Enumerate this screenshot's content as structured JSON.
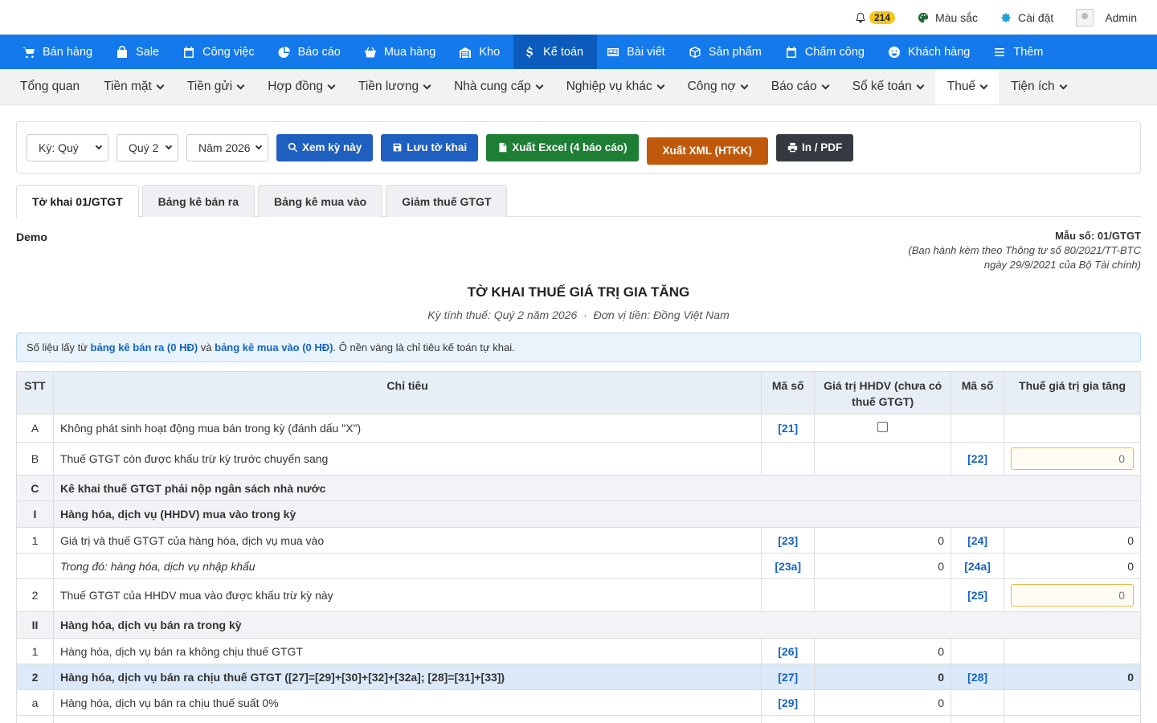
{
  "topbar": {
    "notif_count": "214",
    "color_label": "Màu sắc",
    "settings_label": "Cài đặt",
    "user_label": "Admin"
  },
  "mainnav": [
    {
      "label": "Bán hàng",
      "icon": "cart-icon"
    },
    {
      "label": "Sale",
      "icon": "bag-icon"
    },
    {
      "label": "Công việc",
      "icon": "calendar-icon"
    },
    {
      "label": "Báo cáo",
      "icon": "pie-chart-icon"
    },
    {
      "label": "Mua hàng",
      "icon": "basket-icon"
    },
    {
      "label": "Kho",
      "icon": "warehouse-icon"
    },
    {
      "label": "Kế toán",
      "icon": "dollar-icon",
      "active": true
    },
    {
      "label": "Bài viết",
      "icon": "article-icon"
    },
    {
      "label": "Sản phẩm",
      "icon": "box-icon"
    },
    {
      "label": "Chấm công",
      "icon": "calendar-check-icon"
    },
    {
      "label": "Khách hàng",
      "icon": "smile-icon"
    },
    {
      "label": "Thêm",
      "icon": "menu-icon"
    }
  ],
  "subnav": [
    {
      "label": "Tổng quan",
      "dropdown": false
    },
    {
      "label": "Tiền mặt",
      "dropdown": true
    },
    {
      "label": "Tiền gửi",
      "dropdown": true
    },
    {
      "label": "Hợp đồng",
      "dropdown": true
    },
    {
      "label": "Tiền lương",
      "dropdown": true
    },
    {
      "label": "Nhà cung cấp",
      "dropdown": true
    },
    {
      "label": "Nghiệp vụ khác",
      "dropdown": true
    },
    {
      "label": "Công nợ",
      "dropdown": true
    },
    {
      "label": "Báo cáo",
      "dropdown": true
    },
    {
      "label": "Sổ kế toán",
      "dropdown": true
    },
    {
      "label": "Thuế",
      "dropdown": true,
      "active": true
    },
    {
      "label": "Tiện ích",
      "dropdown": true
    }
  ],
  "toolbar": {
    "period_type": "Kỳ: Quý",
    "quarter": "Quý 2",
    "year": "Năm 2026",
    "view_btn": "Xem kỳ này",
    "save_btn": "Lưu tờ khai",
    "excel_btn": "Xuất Excel (4 báo cáo)",
    "xml_btn": "Xuất XML (HTKK)",
    "print_btn": "In / PDF"
  },
  "tabs": [
    {
      "label": "Tờ khai 01/GTGT",
      "active": true
    },
    {
      "label": "Bảng kê bán ra"
    },
    {
      "label": "Bảng kê mua vào"
    },
    {
      "label": "Giảm thuế GTGT"
    }
  ],
  "header": {
    "company": "Demo",
    "form_no": "Mẫu số: 01/GTGT",
    "issued_line1": "(Ban hành kèm theo Thông tư số 80/2021/TT-BTC",
    "issued_line2": "ngày 29/9/2021 của Bộ Tài chính)",
    "title": "TỜ KHAI THUẾ GIÁ TRỊ GIA TĂNG",
    "period": "Kỳ tính thuế: Quý 2 năm 2026  ·  Đơn vị tiền: Đồng Việt Nam"
  },
  "note": {
    "prefix": "Số liệu lấy từ ",
    "link1": "bảng kê bán ra (0 HĐ)",
    "mid": " và ",
    "link2": "bảng kê mua vào (0 HĐ)",
    "suffix": ". Ô nền vàng là chỉ tiêu kế toán tự khai."
  },
  "table": {
    "headers": {
      "stt": "STT",
      "item": "Chỉ tiêu",
      "code1": "Mã số",
      "value": "Giá trị HHDV (chưa có thuế GTGT)",
      "code2": "Mã số",
      "tax": "Thuế giá trị gia tăng"
    },
    "rows": {
      "rA": {
        "stt": "A",
        "item": "Không phát sinh hoạt động mua bán trong kỳ (đánh dấu \"X\")",
        "code1": "[21]"
      },
      "rB": {
        "stt": "B",
        "item": "Thuế GTGT còn được khấu trừ kỳ trước chuyển sang",
        "code2": "[22]",
        "tax": "0"
      },
      "rC": {
        "stt": "C",
        "item": "Kê khai thuế GTGT phải nộp ngân sách nhà nước"
      },
      "rI": {
        "stt": "I",
        "item": "Hàng hóa, dịch vụ (HHDV) mua vào trong kỳ"
      },
      "r1": {
        "stt": "1",
        "item": "Giá trị và thuế GTGT của hàng hóa, dịch vụ mua vào",
        "code1": "[23]",
        "value": "0",
        "code2": "[24]",
        "tax": "0"
      },
      "r1a": {
        "stt": "",
        "item": "Trong đó: hàng hóa, dịch vụ nhập khẩu",
        "code1": "[23a]",
        "value": "0",
        "code2": "[24a]",
        "tax": "0"
      },
      "r2": {
        "stt": "2",
        "item": "Thuế GTGT của HHDV mua vào được khấu trừ kỳ này",
        "code2": "[25]",
        "tax": "0"
      },
      "rII": {
        "stt": "II",
        "item": "Hàng hóa, dịch vụ bán ra trong kỳ"
      },
      "rII1": {
        "stt": "1",
        "item": "Hàng hóa, dịch vụ bán ra không chịu thuế GTGT",
        "code1": "[26]",
        "value": "0"
      },
      "rII2": {
        "stt": "2",
        "item": "Hàng hóa, dịch vụ bán ra chịu thuế GTGT ([27]=[29]+[30]+[32]+[32a]; [28]=[31]+[33])",
        "code1": "[27]",
        "value": "0",
        "code2": "[28]",
        "tax": "0"
      },
      "rIIa": {
        "stt": "a",
        "item": "Hàng hóa, dịch vụ bán ra chịu thuế suất 0%",
        "code1": "[29]",
        "value": "0"
      }
    }
  }
}
